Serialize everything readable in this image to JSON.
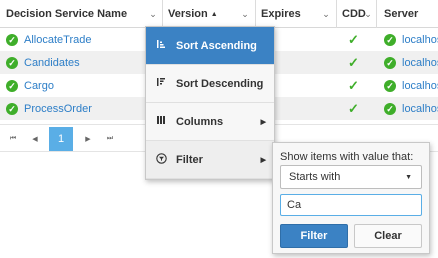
{
  "columns": {
    "name": {
      "label": "Decision Service Name",
      "sort": "▲",
      "menu": "⌄"
    },
    "version": {
      "label": "Version",
      "sort": "▲",
      "menu": "⌄"
    },
    "expires": {
      "label": "Expires",
      "menu": "⌄"
    },
    "cdd": {
      "label": "CDD",
      "menu": "⌄"
    },
    "server": {
      "label": "Server"
    }
  },
  "rows": [
    {
      "name": "AllocateTrade",
      "cdd": "✓",
      "server": "localhos"
    },
    {
      "name": "Candidates",
      "cdd": "✓",
      "server": "localhos"
    },
    {
      "name": "Cargo",
      "cdd": "✓",
      "server": "localhos"
    },
    {
      "name": "ProcessOrder",
      "cdd": "✓",
      "server": "localhos"
    }
  ],
  "pager": {
    "first": "⏮",
    "prev": "◀",
    "current_page": "1",
    "next": "▶",
    "last": "⏭"
  },
  "column_menu": {
    "items": [
      {
        "label": "Sort Ascending",
        "icon": "sort-ascending-icon"
      },
      {
        "label": "Sort Descending",
        "icon": "sort-descending-icon"
      },
      {
        "label": "Columns",
        "icon": "columns-icon",
        "arrow": "▶"
      },
      {
        "label": "Filter",
        "icon": "filter-icon",
        "arrow": "▶"
      }
    ]
  },
  "filter_popup": {
    "title": "Show items with value that:",
    "operator": "Starts with",
    "value": "Ca",
    "filter_label": "Filter",
    "clear_label": "Clear"
  },
  "colors": {
    "accent": "#3b82c4",
    "active_page": "#5aaee6",
    "success": "#3fae2a",
    "link": "#2d7ec7"
  }
}
